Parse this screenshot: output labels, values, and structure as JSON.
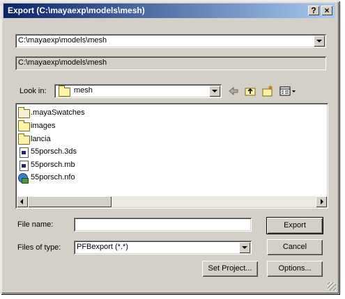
{
  "window": {
    "title": "Export (C:\\mayaexp\\models\\mesh)",
    "help_button": "?",
    "close_button": "×"
  },
  "path_combo": {
    "value": "C:\\mayaexp\\models\\mesh"
  },
  "path_display": {
    "value": "C:\\mayaexp\\models\\mesh"
  },
  "look_in": {
    "label": "Look in:",
    "value": "mesh",
    "icons": [
      "back-arrow-icon",
      "up-folder-icon",
      "new-folder-icon",
      "view-menu-icon"
    ]
  },
  "files": [
    {
      "name": ".mayaSwatches",
      "icon": "folder-icon"
    },
    {
      "name": "images",
      "icon": "folder-icon"
    },
    {
      "name": "lancia",
      "icon": "folder-icon"
    },
    {
      "name": "55porsch.3ds",
      "icon": "file-icon"
    },
    {
      "name": "55porsch.mb",
      "icon": "file-icon"
    },
    {
      "name": "55porsch.nfo",
      "icon": "info-file-icon"
    }
  ],
  "file_name": {
    "label": "File name:",
    "value": ""
  },
  "file_type": {
    "label": "Files of type:",
    "value": "PFBexport (*.*)"
  },
  "buttons": {
    "export": "Export",
    "cancel": "Cancel",
    "set_project": "Set Project...",
    "options": "Options..."
  },
  "colors": {
    "titlebar_start": "#0a246a",
    "titlebar_end": "#a6caf0",
    "face": "#d4d0c8"
  }
}
